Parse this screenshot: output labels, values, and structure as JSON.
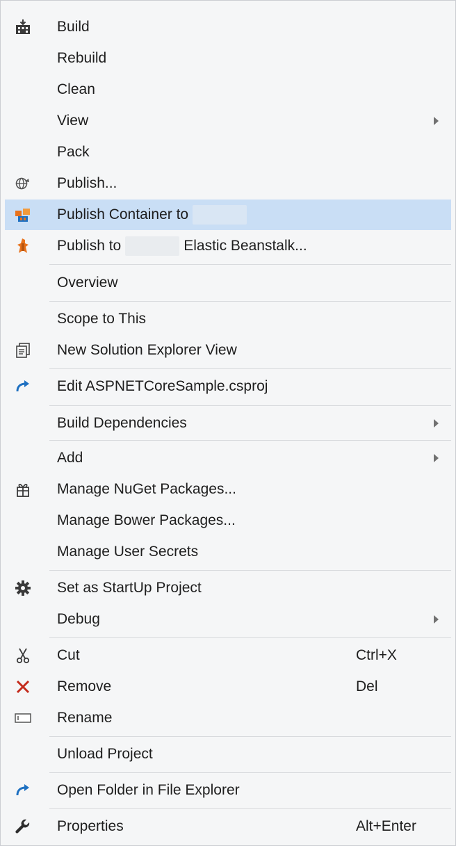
{
  "menu": {
    "items": [
      {
        "label": "Build",
        "icon": "build-icon"
      },
      {
        "label": "Rebuild"
      },
      {
        "label": "Clean"
      },
      {
        "label": "View",
        "submenu": true
      },
      {
        "label": "Pack"
      },
      {
        "label": "Publish...",
        "icon": "globe-publish-icon"
      },
      {
        "label_start": "Publish Container to",
        "label_end": "",
        "icon": "aws-container-icon",
        "highlighted": true
      },
      {
        "label_start": "Publish to",
        "label_end": "Elastic Beanstalk...",
        "icon": "aws-beanstalk-icon"
      },
      {
        "label": "Overview"
      },
      {
        "label": "Scope to This"
      },
      {
        "label": "New Solution Explorer View",
        "icon": "new-view-icon"
      },
      {
        "label": "Edit ASPNETCoreSample.csproj",
        "icon": "edit-arrow-icon"
      },
      {
        "label": "Build Dependencies",
        "submenu": true
      },
      {
        "label": "Add",
        "submenu": true
      },
      {
        "label": "Manage NuGet Packages...",
        "icon": "nuget-package-icon"
      },
      {
        "label": "Manage Bower Packages..."
      },
      {
        "label": "Manage User Secrets"
      },
      {
        "label": "Set as StartUp Project",
        "icon": "gear-icon"
      },
      {
        "label": "Debug",
        "submenu": true
      },
      {
        "label": "Cut",
        "shortcut": "Ctrl+X",
        "icon": "scissors-icon"
      },
      {
        "label": "Remove",
        "shortcut": "Del",
        "icon": "remove-x-icon"
      },
      {
        "label": "Rename",
        "icon": "rename-icon"
      },
      {
        "label": "Unload Project"
      },
      {
        "label": "Open Folder in File Explorer",
        "icon": "open-folder-arrow-icon"
      },
      {
        "label": "Properties",
        "shortcut": "Alt+Enter",
        "icon": "wrench-icon"
      }
    ]
  },
  "colors": {
    "menu_bg": "#f5f6f7",
    "highlight": "#c9def5",
    "separator": "#d8dadd",
    "aws_orange": "#e8731d",
    "vs_blue": "#1e70c1",
    "remove_red": "#c42b1c",
    "text": "#1e1e1e"
  }
}
